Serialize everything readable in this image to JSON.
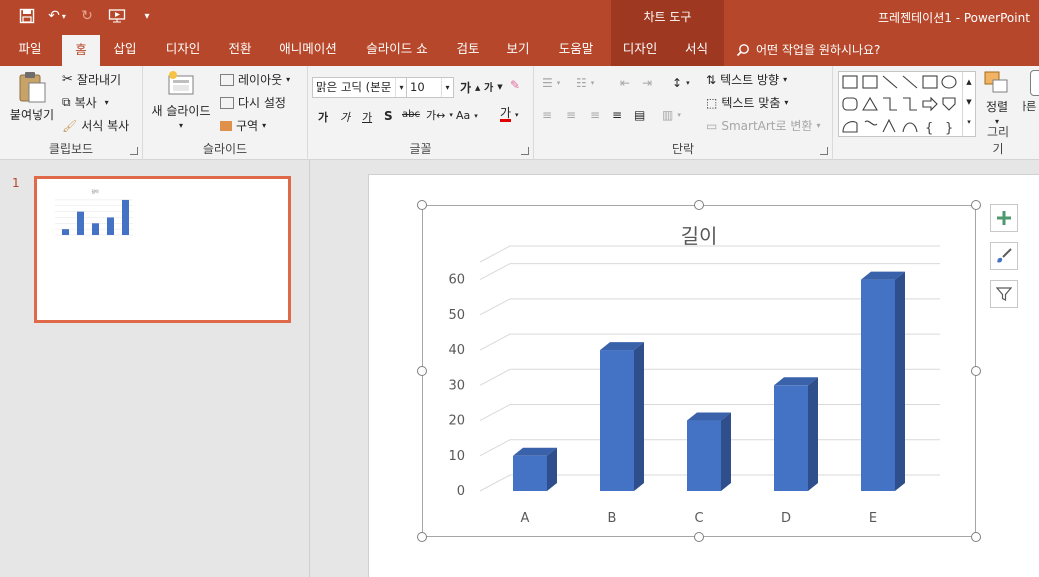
{
  "app": {
    "context_tab_title": "차트 도구",
    "doc_title": "프레젠테이션1 - PowerPoint"
  },
  "tabs": [
    {
      "label": "파일",
      "id": "file"
    },
    {
      "label": "홈",
      "id": "home",
      "active": true
    },
    {
      "label": "삽입",
      "id": "insert"
    },
    {
      "label": "디자인",
      "id": "design"
    },
    {
      "label": "전환",
      "id": "transitions"
    },
    {
      "label": "애니메이션",
      "id": "animations"
    },
    {
      "label": "슬라이드 쇼",
      "id": "slideshow"
    },
    {
      "label": "검토",
      "id": "review"
    },
    {
      "label": "보기",
      "id": "view"
    },
    {
      "label": "도움말",
      "id": "help"
    },
    {
      "label": "디자인",
      "id": "chart-design",
      "contextual": true
    },
    {
      "label": "서식",
      "id": "chart-format",
      "contextual": true
    }
  ],
  "tell_me": "어떤 작업을 원하시나요?",
  "ribbon": {
    "clipboard": {
      "label": "클립보드",
      "paste": "붙여넣기",
      "cut": "잘라내기",
      "copy": "복사",
      "format_painter": "서식 복사"
    },
    "slides": {
      "label": "슬라이드",
      "new_slide": "새 슬라이드",
      "layout": "레이아웃",
      "reset": "다시 설정",
      "section": "구역"
    },
    "font": {
      "label": "글꼴",
      "font_name": "맑은 고딕 (본문",
      "font_size": "10"
    },
    "paragraph": {
      "label": "단락",
      "text_direction": "텍스트 방향",
      "align_text": "텍스트 맞춤",
      "smartart": "SmartArt로 변환"
    },
    "drawing": {
      "label": "그리기",
      "arrange": "정렬",
      "quick_styles": "빠른 스타일"
    }
  },
  "slide_panel": {
    "slide_number": "1"
  },
  "colors": {
    "accent": "#b7472a",
    "bar": "#4472c4"
  },
  "chart_data": {
    "type": "bar",
    "title": "길이",
    "categories": [
      "A",
      "B",
      "C",
      "D",
      "E"
    ],
    "values": [
      10,
      40,
      20,
      30,
      60
    ],
    "y_ticks": [
      "0",
      "10",
      "20",
      "30",
      "40",
      "50",
      "60"
    ],
    "ylim": [
      0,
      65
    ],
    "grid": true,
    "style": "3d-column"
  }
}
